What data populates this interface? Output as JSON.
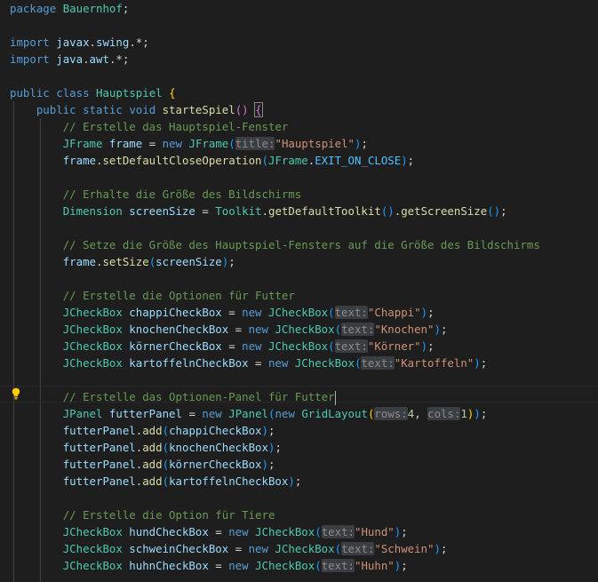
{
  "colors": {
    "background": "#1e1e1e",
    "keyword": "#569cd6",
    "type": "#4ec9b0",
    "function": "#dcdcaa",
    "variable": "#9cdcfe",
    "constant": "#4fc1ff",
    "string": "#ce9178",
    "number": "#b5cea8",
    "comment": "#6a9955",
    "inlay_hint_bg": "#3a3d41"
  },
  "icons": {
    "lightbulb": "lightbulb-icon"
  },
  "lines": [
    [
      {
        "t": "package",
        "c": "kw"
      },
      {
        "t": " "
      },
      {
        "t": "Bauernhof",
        "c": "ty"
      },
      {
        "t": ";"
      }
    ],
    [],
    [
      {
        "t": "import",
        "c": "kw"
      },
      {
        "t": " "
      },
      {
        "t": "javax",
        "c": "vr"
      },
      {
        "t": "."
      },
      {
        "t": "swing",
        "c": "vr"
      },
      {
        "t": ".*;"
      }
    ],
    [
      {
        "t": "import",
        "c": "kw"
      },
      {
        "t": " "
      },
      {
        "t": "java",
        "c": "vr"
      },
      {
        "t": "."
      },
      {
        "t": "awt",
        "c": "vr"
      },
      {
        "t": ".*;"
      }
    ],
    [],
    [
      {
        "t": "public",
        "c": "kw"
      },
      {
        "t": " "
      },
      {
        "t": "class",
        "c": "kw"
      },
      {
        "t": " "
      },
      {
        "t": "Hauptspiel",
        "c": "ty"
      },
      {
        "t": " "
      },
      {
        "t": "{",
        "c": "br1"
      }
    ],
    [
      {
        "t": "    "
      },
      {
        "t": "public",
        "c": "kw"
      },
      {
        "t": " "
      },
      {
        "t": "static",
        "c": "kw"
      },
      {
        "t": " "
      },
      {
        "t": "void",
        "c": "kw"
      },
      {
        "t": " "
      },
      {
        "t": "starteSpiel",
        "c": "fn"
      },
      {
        "t": "()",
        "c": "br2"
      },
      {
        "t": " "
      },
      {
        "t": "{",
        "c": "br2 bm"
      }
    ],
    [
      {
        "t": "        "
      },
      {
        "t": "// Erstelle das Hauptspiel-Fenster",
        "c": "cm"
      }
    ],
    [
      {
        "t": "        "
      },
      {
        "t": "JFrame",
        "c": "ty"
      },
      {
        "t": " "
      },
      {
        "t": "frame",
        "c": "vr"
      },
      {
        "t": " = "
      },
      {
        "t": "new",
        "c": "kw"
      },
      {
        "t": " "
      },
      {
        "t": "JFrame",
        "c": "ty"
      },
      {
        "t": "(",
        "c": "br3"
      },
      {
        "t": "title:",
        "c": "hint"
      },
      {
        "t": "\"Hauptspiel\"",
        "c": "st"
      },
      {
        "t": ")",
        "c": "br3"
      },
      {
        "t": ";"
      }
    ],
    [
      {
        "t": "        "
      },
      {
        "t": "frame",
        "c": "vr"
      },
      {
        "t": "."
      },
      {
        "t": "setDefaultCloseOperation",
        "c": "fn"
      },
      {
        "t": "(",
        "c": "br3"
      },
      {
        "t": "JFrame",
        "c": "ty"
      },
      {
        "t": "."
      },
      {
        "t": "EXIT_ON_CLOSE",
        "c": "cn"
      },
      {
        "t": ")",
        "c": "br3"
      },
      {
        "t": ";"
      }
    ],
    [],
    [
      {
        "t": "        "
      },
      {
        "t": "// Erhalte die Größe des Bildschirms",
        "c": "cm"
      }
    ],
    [
      {
        "t": "        "
      },
      {
        "t": "Dimension",
        "c": "ty"
      },
      {
        "t": " "
      },
      {
        "t": "screenSize",
        "c": "vr"
      },
      {
        "t": " = "
      },
      {
        "t": "Toolkit",
        "c": "ty"
      },
      {
        "t": "."
      },
      {
        "t": "getDefaultToolkit",
        "c": "fn"
      },
      {
        "t": "()",
        "c": "br3"
      },
      {
        "t": "."
      },
      {
        "t": "getScreenSize",
        "c": "fn"
      },
      {
        "t": "()",
        "c": "br3"
      },
      {
        "t": ";"
      }
    ],
    [],
    [
      {
        "t": "        "
      },
      {
        "t": "// Setze die Größe des Hauptspiel-Fensters auf die Größe des Bildschirms",
        "c": "cm"
      }
    ],
    [
      {
        "t": "        "
      },
      {
        "t": "frame",
        "c": "vr"
      },
      {
        "t": "."
      },
      {
        "t": "setSize",
        "c": "fn"
      },
      {
        "t": "(",
        "c": "br3"
      },
      {
        "t": "screenSize",
        "c": "vr"
      },
      {
        "t": ")",
        "c": "br3"
      },
      {
        "t": ";"
      }
    ],
    [],
    [
      {
        "t": "        "
      },
      {
        "t": "// Erstelle die Optionen für Futter",
        "c": "cm"
      }
    ],
    [
      {
        "t": "        "
      },
      {
        "t": "JCheckBox",
        "c": "ty"
      },
      {
        "t": " "
      },
      {
        "t": "chappiCheckBox",
        "c": "vr"
      },
      {
        "t": " = "
      },
      {
        "t": "new",
        "c": "kw"
      },
      {
        "t": " "
      },
      {
        "t": "JCheckBox",
        "c": "ty"
      },
      {
        "t": "(",
        "c": "br3"
      },
      {
        "t": "text:",
        "c": "hint"
      },
      {
        "t": "\"Chappi\"",
        "c": "st"
      },
      {
        "t": ")",
        "c": "br3"
      },
      {
        "t": ";"
      }
    ],
    [
      {
        "t": "        "
      },
      {
        "t": "JCheckBox",
        "c": "ty"
      },
      {
        "t": " "
      },
      {
        "t": "knochenCheckBox",
        "c": "vr"
      },
      {
        "t": " = "
      },
      {
        "t": "new",
        "c": "kw"
      },
      {
        "t": " "
      },
      {
        "t": "JCheckBox",
        "c": "ty"
      },
      {
        "t": "(",
        "c": "br3"
      },
      {
        "t": "text:",
        "c": "hint"
      },
      {
        "t": "\"Knochen\"",
        "c": "st"
      },
      {
        "t": ")",
        "c": "br3"
      },
      {
        "t": ";"
      }
    ],
    [
      {
        "t": "        "
      },
      {
        "t": "JCheckBox",
        "c": "ty"
      },
      {
        "t": " "
      },
      {
        "t": "körnerCheckBox",
        "c": "vr"
      },
      {
        "t": " = "
      },
      {
        "t": "new",
        "c": "kw"
      },
      {
        "t": " "
      },
      {
        "t": "JCheckBox",
        "c": "ty"
      },
      {
        "t": "(",
        "c": "br3"
      },
      {
        "t": "text:",
        "c": "hint"
      },
      {
        "t": "\"Körner\"",
        "c": "st"
      },
      {
        "t": ")",
        "c": "br3"
      },
      {
        "t": ";"
      }
    ],
    [
      {
        "t": "        "
      },
      {
        "t": "JCheckBox",
        "c": "ty"
      },
      {
        "t": " "
      },
      {
        "t": "kartoffelnCheckBox",
        "c": "vr"
      },
      {
        "t": " = "
      },
      {
        "t": "new",
        "c": "kw"
      },
      {
        "t": " "
      },
      {
        "t": "JCheckBox",
        "c": "ty"
      },
      {
        "t": "(",
        "c": "br3"
      },
      {
        "t": "text:",
        "c": "hint"
      },
      {
        "t": "\"Kartoffeln\"",
        "c": "st"
      },
      {
        "t": ")",
        "c": "br3"
      },
      {
        "t": ";"
      }
    ],
    [],
    [
      {
        "t": "        "
      },
      {
        "t": "// Erstelle das Optionen-Panel für Futter",
        "c": "cm"
      },
      {
        "caret": true
      }
    ],
    [
      {
        "t": "        "
      },
      {
        "t": "JPanel",
        "c": "ty"
      },
      {
        "t": " "
      },
      {
        "t": "futterPanel",
        "c": "vr"
      },
      {
        "t": " = "
      },
      {
        "t": "new",
        "c": "kw"
      },
      {
        "t": " "
      },
      {
        "t": "JPanel",
        "c": "ty"
      },
      {
        "t": "(",
        "c": "br3"
      },
      {
        "t": "new",
        "c": "kw"
      },
      {
        "t": " "
      },
      {
        "t": "GridLayout",
        "c": "ty"
      },
      {
        "t": "(",
        "c": "br1"
      },
      {
        "t": "rows:",
        "c": "hint"
      },
      {
        "t": "4",
        "c": "nu"
      },
      {
        "t": ", "
      },
      {
        "t": "cols:",
        "c": "hint"
      },
      {
        "t": "1",
        "c": "nu"
      },
      {
        "t": ")",
        "c": "br1"
      },
      {
        "t": ")",
        "c": "br3"
      },
      {
        "t": ";"
      }
    ],
    [
      {
        "t": "        "
      },
      {
        "t": "futterPanel",
        "c": "vr"
      },
      {
        "t": "."
      },
      {
        "t": "add",
        "c": "fn"
      },
      {
        "t": "(",
        "c": "br3"
      },
      {
        "t": "chappiCheckBox",
        "c": "vr"
      },
      {
        "t": ")",
        "c": "br3"
      },
      {
        "t": ";"
      }
    ],
    [
      {
        "t": "        "
      },
      {
        "t": "futterPanel",
        "c": "vr"
      },
      {
        "t": "."
      },
      {
        "t": "add",
        "c": "fn"
      },
      {
        "t": "(",
        "c": "br3"
      },
      {
        "t": "knochenCheckBox",
        "c": "vr"
      },
      {
        "t": ")",
        "c": "br3"
      },
      {
        "t": ";"
      }
    ],
    [
      {
        "t": "        "
      },
      {
        "t": "futterPanel",
        "c": "vr"
      },
      {
        "t": "."
      },
      {
        "t": "add",
        "c": "fn"
      },
      {
        "t": "(",
        "c": "br3"
      },
      {
        "t": "körnerCheckBox",
        "c": "vr"
      },
      {
        "t": ")",
        "c": "br3"
      },
      {
        "t": ";"
      }
    ],
    [
      {
        "t": "        "
      },
      {
        "t": "futterPanel",
        "c": "vr"
      },
      {
        "t": "."
      },
      {
        "t": "add",
        "c": "fn"
      },
      {
        "t": "(",
        "c": "br3"
      },
      {
        "t": "kartoffelnCheckBox",
        "c": "vr"
      },
      {
        "t": ")",
        "c": "br3"
      },
      {
        "t": ";"
      }
    ],
    [],
    [
      {
        "t": "        "
      },
      {
        "t": "// Erstelle die Option für Tiere",
        "c": "cm"
      }
    ],
    [
      {
        "t": "        "
      },
      {
        "t": "JCheckBox",
        "c": "ty"
      },
      {
        "t": " "
      },
      {
        "t": "hundCheckBox",
        "c": "vr"
      },
      {
        "t": " = "
      },
      {
        "t": "new",
        "c": "kw"
      },
      {
        "t": " "
      },
      {
        "t": "JCheckBox",
        "c": "ty"
      },
      {
        "t": "(",
        "c": "br3"
      },
      {
        "t": "text:",
        "c": "hint"
      },
      {
        "t": "\"Hund\"",
        "c": "st"
      },
      {
        "t": ")",
        "c": "br3"
      },
      {
        "t": ";"
      }
    ],
    [
      {
        "t": "        "
      },
      {
        "t": "JCheckBox",
        "c": "ty"
      },
      {
        "t": " "
      },
      {
        "t": "schweinCheckBox",
        "c": "vr"
      },
      {
        "t": " = "
      },
      {
        "t": "new",
        "c": "kw"
      },
      {
        "t": " "
      },
      {
        "t": "JCheckBox",
        "c": "ty"
      },
      {
        "t": "(",
        "c": "br3"
      },
      {
        "t": "text:",
        "c": "hint"
      },
      {
        "t": "\"Schwein\"",
        "c": "st"
      },
      {
        "t": ")",
        "c": "br3"
      },
      {
        "t": ";"
      }
    ],
    [
      {
        "t": "        "
      },
      {
        "t": "JCheckBox",
        "c": "ty"
      },
      {
        "t": " "
      },
      {
        "t": "huhnCheckBox",
        "c": "vr"
      },
      {
        "t": " = "
      },
      {
        "t": "new",
        "c": "kw"
      },
      {
        "t": " "
      },
      {
        "t": "JCheckBox",
        "c": "ty"
      },
      {
        "t": "(",
        "c": "br3"
      },
      {
        "t": "text:",
        "c": "hint"
      },
      {
        "t": "\"Huhn\"",
        "c": "st"
      },
      {
        "t": ")",
        "c": "br3"
      },
      {
        "t": ";"
      }
    ]
  ]
}
